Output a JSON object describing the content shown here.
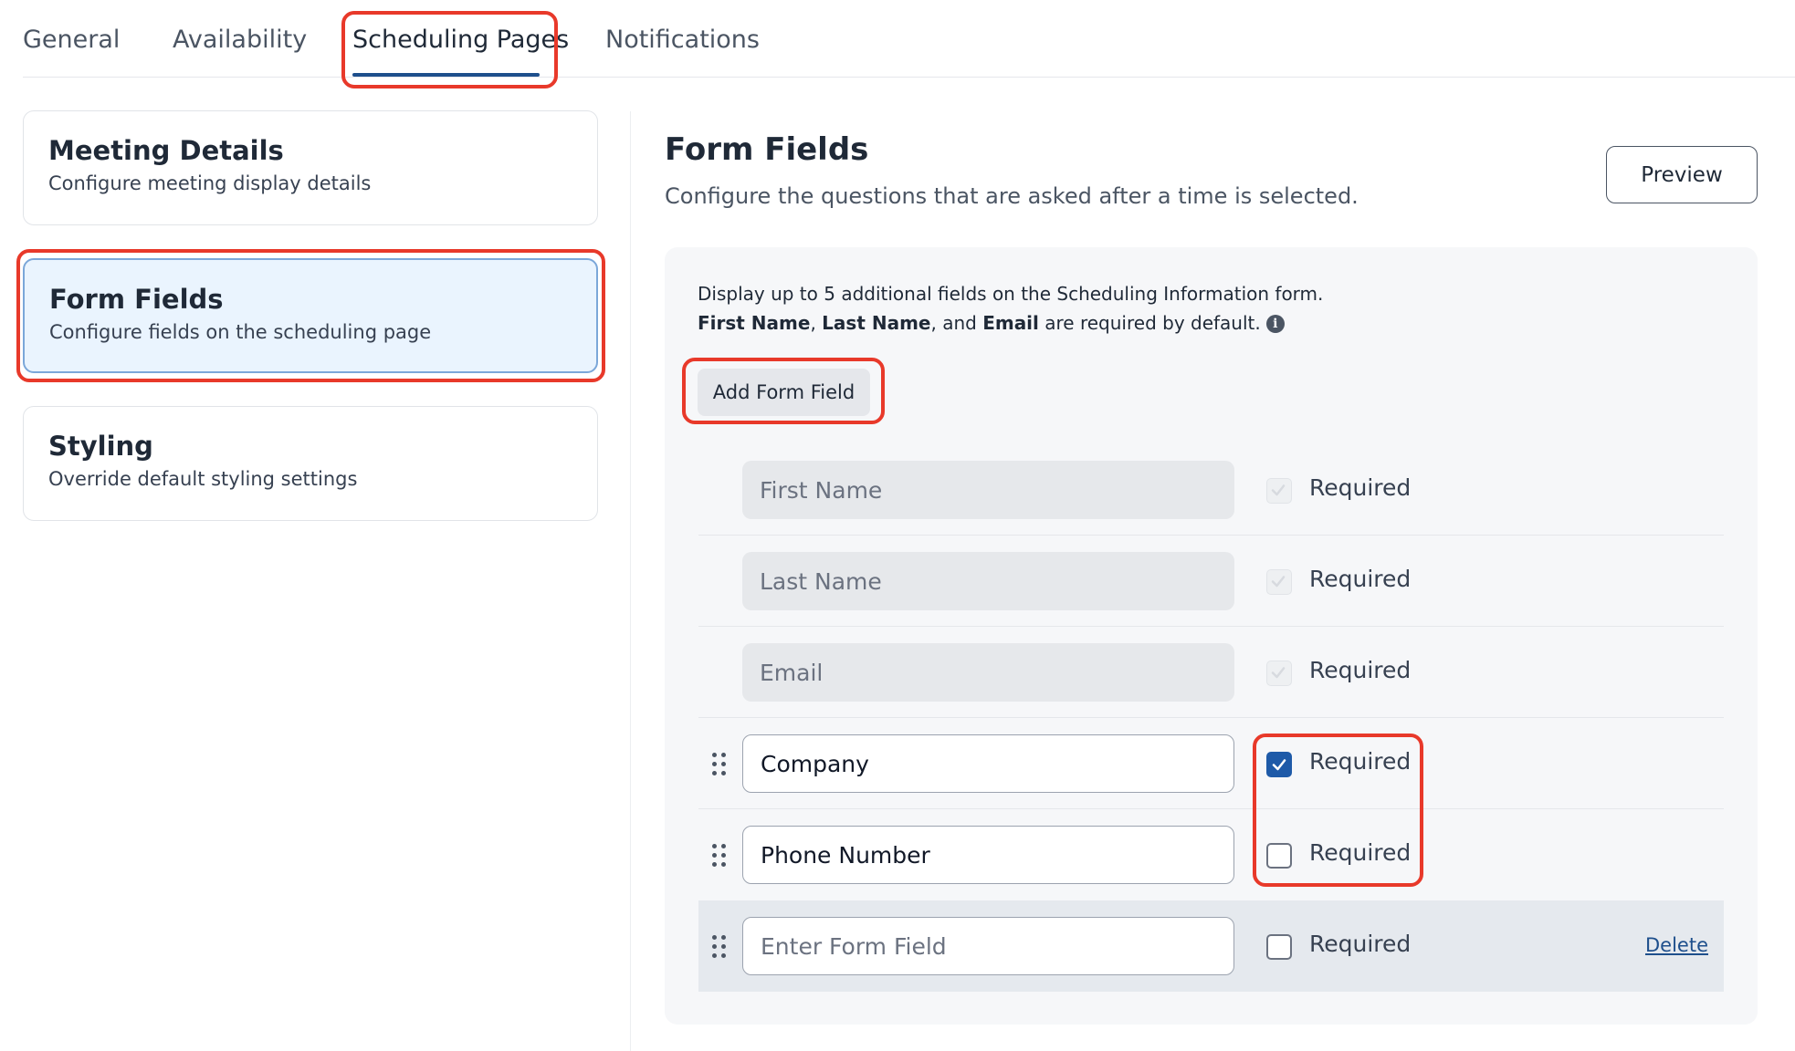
{
  "tabs": [
    {
      "label": "General"
    },
    {
      "label": "Availability"
    },
    {
      "label": "Scheduling Pages",
      "active": true
    },
    {
      "label": "Notifications"
    }
  ],
  "sidebar": {
    "cards": [
      {
        "title": "Meeting Details",
        "description": "Configure meeting display details"
      },
      {
        "title": "Form Fields",
        "description": "Configure fields on the scheduling page",
        "active": true
      },
      {
        "title": "Styling",
        "description": "Override default styling settings"
      }
    ]
  },
  "main": {
    "title": "Form Fields",
    "subtitle": "Configure the questions that are asked after a time is selected.",
    "preview_label": "Preview"
  },
  "panel": {
    "info_line1": "Display up to 5 additional fields on the Scheduling Information form.",
    "info_line2": {
      "first_name": "First Name",
      "sep1": ", ",
      "last_name": "Last Name",
      "sep2": ", and ",
      "email": "Email",
      "rest": " are required by default."
    },
    "info_icon": "i",
    "add_field_label": "Add Form Field",
    "required_label": "Required",
    "delete_label": "Delete",
    "fields": [
      {
        "value": "First Name",
        "locked": true,
        "required": true
      },
      {
        "value": "Last Name",
        "locked": true,
        "required": true
      },
      {
        "value": "Email",
        "locked": true,
        "required": true
      },
      {
        "value": "Company",
        "locked": false,
        "required": true
      },
      {
        "value": "Phone Number",
        "locked": false,
        "required": false
      },
      {
        "value": "",
        "placeholder": "Enter Form Field",
        "locked": false,
        "required": false,
        "deletable": true
      }
    ]
  },
  "colors": {
    "accent": "#1e4f8c",
    "checkbox_checked": "#1e5aa8",
    "highlight": "#e8392a",
    "active_card_bg": "#eaf4fe"
  }
}
